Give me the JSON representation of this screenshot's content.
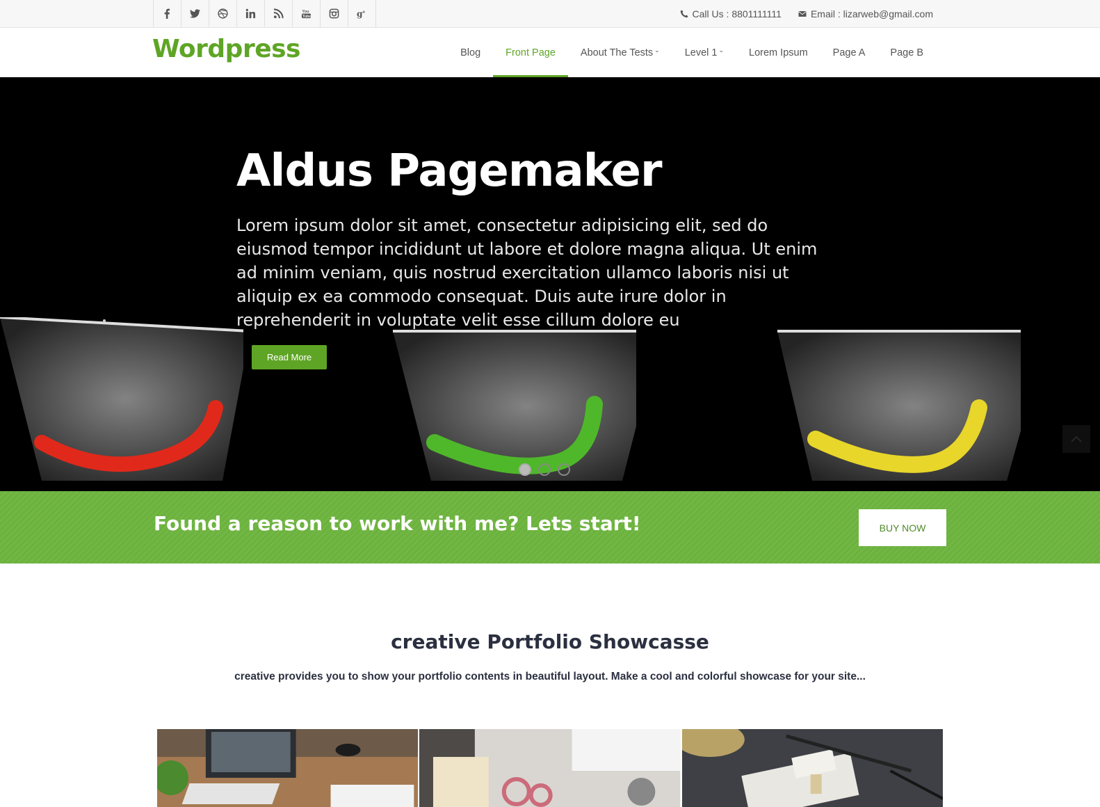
{
  "topbar": {
    "social": [
      "facebook-icon",
      "twitter-icon",
      "dribbble-icon",
      "linkedin-icon",
      "rss-icon",
      "youtube-icon",
      "instagram-icon",
      "google-plus-icon"
    ],
    "call": "Call Us : 8801111111",
    "email": "Email : lizarweb@gmail.com"
  },
  "header": {
    "logo": "Wordpress",
    "nav": [
      {
        "label": "Blog"
      },
      {
        "label": "Front Page",
        "active": true
      },
      {
        "label": "About The Tests"
      },
      {
        "label": "Level 1"
      },
      {
        "label": "Lorem Ipsum"
      },
      {
        "label": "Page A"
      },
      {
        "label": "Page B"
      }
    ],
    "accent": "#5fa525"
  },
  "hero": {
    "title": "Aldus Pagemaker",
    "text": "Lorem ipsum dolor sit amet, consectetur adipisicing elit, sed do eiusmod tempor incididunt ut labore et dolore magna aliqua. Ut enim ad minim veniam, quis nostrud exercitation ullamco laboris nisi ut aliquip ex ea commodo consequat. Duis aute irure dolor in reprehenderit in voluptate velit esse cillum dolore eu",
    "button": "Read More",
    "slides": 3,
    "active_slide": 1
  },
  "cta": {
    "text": "Found a reason to work with me? Lets start!",
    "button": "BUY NOW",
    "color": "#6cb33e"
  },
  "portfolio": {
    "title": "creative Portfolio Showcasse",
    "subtitle": "creative provides you to show your portfolio contents in beautiful layout. Make a cool and colorful showcase for your site..."
  }
}
